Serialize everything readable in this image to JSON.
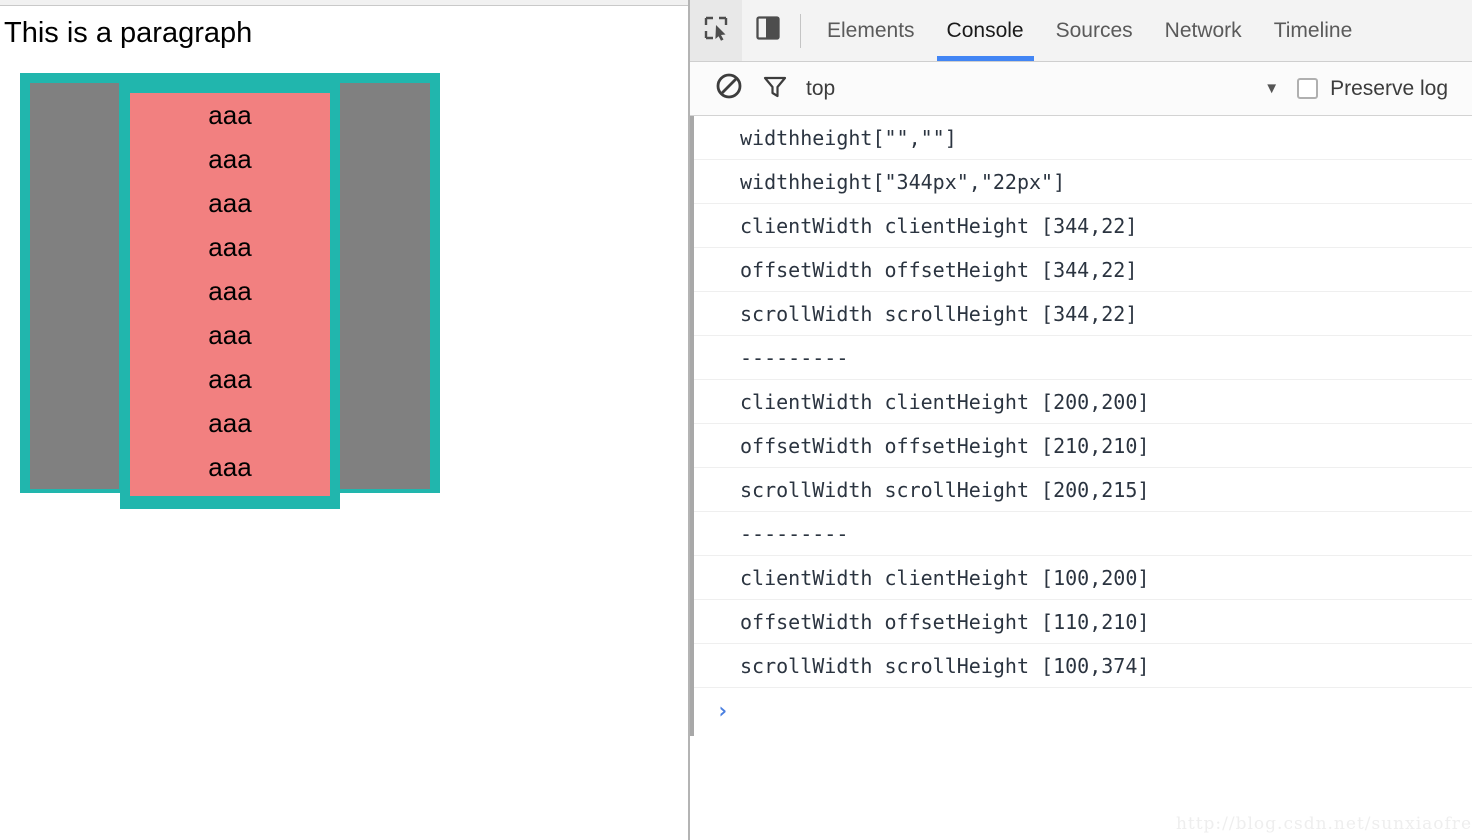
{
  "page": {
    "paragraph": "This is a paragraph",
    "boxes": {
      "outer_color": "#21b6ad",
      "column_color": "#808080",
      "overflow_color": "#f28080",
      "overflow_items": [
        "aaa",
        "aaa",
        "aaa",
        "aaa",
        "aaa",
        "aaa",
        "aaa",
        "aaa",
        "aaa"
      ]
    }
  },
  "devtools": {
    "toolbar": {
      "inspect_icon": "inspect-element-icon",
      "device_icon": "toggle-device-toolbar-icon"
    },
    "tabs": [
      {
        "label": "Elements",
        "active": false
      },
      {
        "label": "Console",
        "active": true
      },
      {
        "label": "Sources",
        "active": false
      },
      {
        "label": "Network",
        "active": false
      },
      {
        "label": "Timeline",
        "active": false
      }
    ],
    "active_tab": "Console",
    "accent_color": "#4285f4",
    "filterbar": {
      "clear_icon": "clear-console-icon",
      "filter_icon": "filter-funnel-icon",
      "context": "top",
      "caret": "▼",
      "preserve_log_label": "Preserve log",
      "preserve_log_checked": false
    },
    "console": {
      "messages": [
        "widthheight[\"\",\"\"]",
        "widthheight[\"344px\",\"22px\"]",
        "clientWidth clientHeight [344,22]",
        "offsetWidth offsetHeight [344,22]",
        "scrollWidth scrollHeight [344,22]",
        "---------",
        "clientWidth clientHeight [200,200]",
        "offsetWidth offsetHeight [210,210]",
        "scrollWidth scrollHeight [200,215]",
        "---------",
        "clientWidth clientHeight [100,200]",
        "offsetWidth offsetHeight [110,210]",
        "scrollWidth scrollHeight [100,374]"
      ],
      "prompt": "›"
    },
    "watermark": "http://blog.csdn.net/sunxiaofre"
  }
}
